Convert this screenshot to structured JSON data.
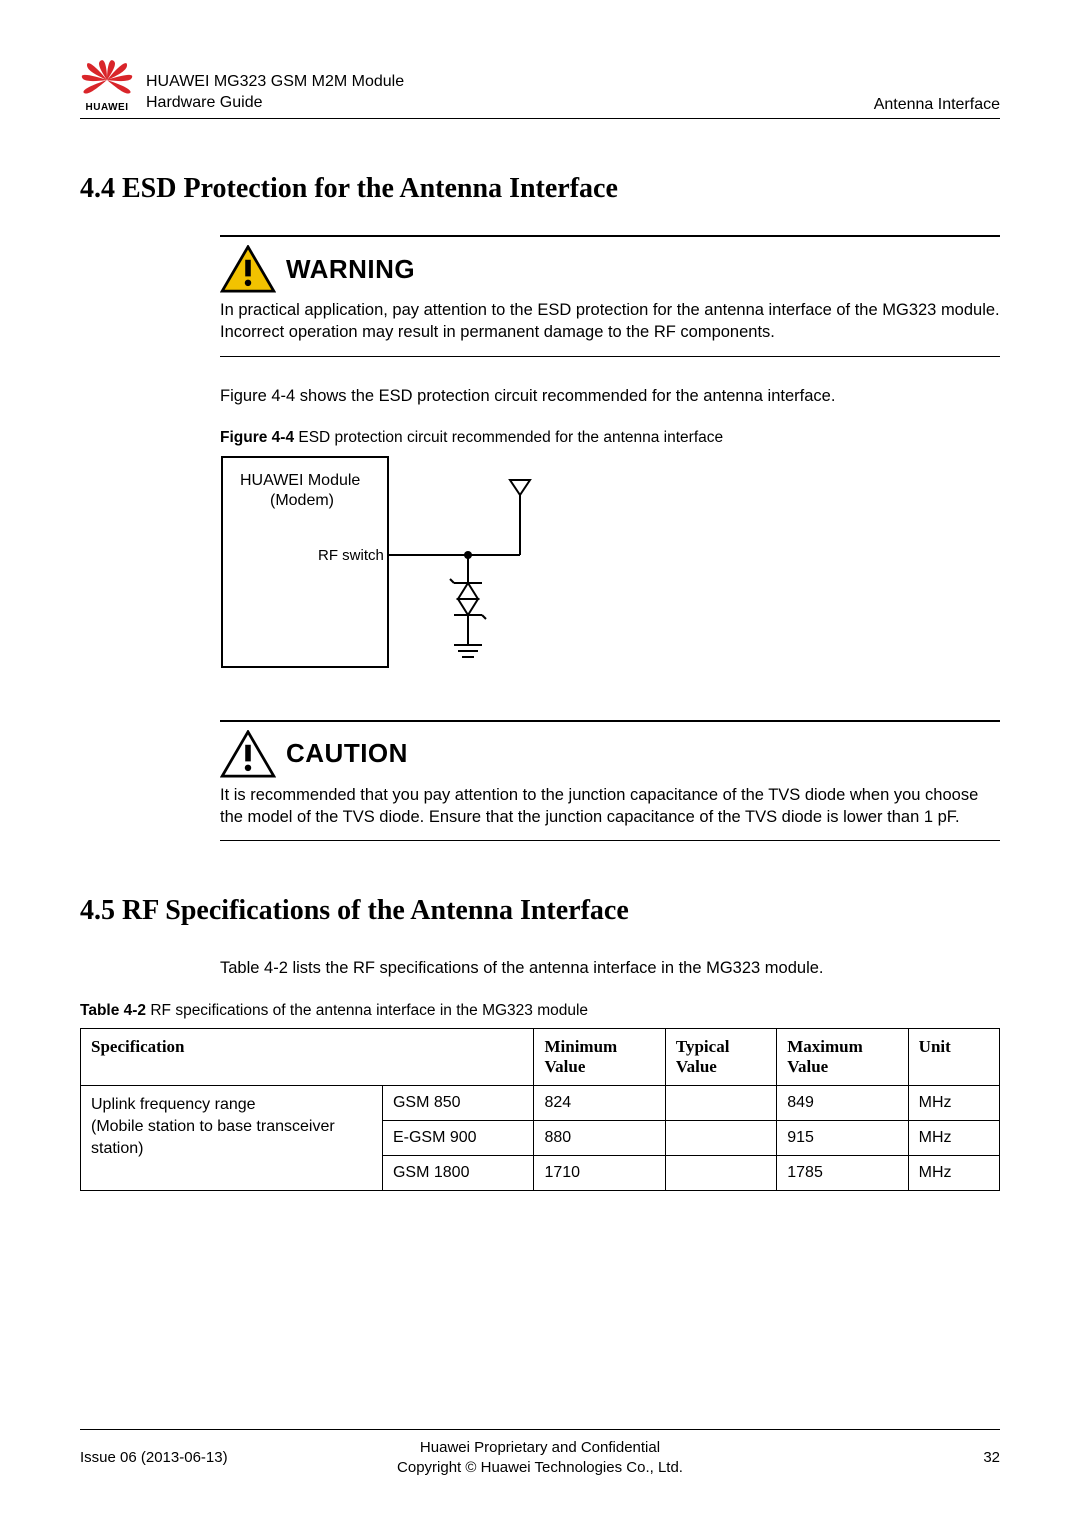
{
  "header": {
    "logo_brand": "HUAWEI",
    "doc_title_line1": "HUAWEI MG323 GSM M2M Module",
    "doc_title_line2": "Hardware Guide",
    "section_label": "Antenna Interface"
  },
  "section44": {
    "heading": "4.4 ESD Protection for the Antenna Interface",
    "warning_label": "WARNING",
    "warning_text": "In practical application, pay attention to the ESD protection for the antenna interface of the MG323 module. Incorrect operation may result in permanent damage to the RF components.",
    "intro_text": "Figure 4-4 shows the ESD protection circuit recommended for the antenna interface.",
    "figure_label": "Figure 4-4",
    "figure_caption": "  ESD protection circuit recommended for the antenna interface",
    "diagram": {
      "module_line1": "HUAWEI Module",
      "module_line2": "(Modem)",
      "port_label": "RF switch"
    },
    "caution_label": "CAUTION",
    "caution_text": "It is recommended that you pay attention to the junction capacitance of the TVS diode when you choose the model of the TVS diode. Ensure that the junction capacitance of the TVS diode is lower than 1 pF."
  },
  "section45": {
    "heading": "4.5 RF Specifications of the Antenna Interface",
    "intro_text": "Table 4-2 lists the RF specifications of the antenna interface in the MG323 module.",
    "table_label": "Table 4-2",
    "table_caption": "  RF specifications of the antenna interface in the MG323 module",
    "headers": {
      "spec": "Specification",
      "min": "Minimum Value",
      "typ": "Typical Value",
      "max": "Maximum Value",
      "unit": "Unit"
    },
    "rowgroup_label_line1": "Uplink frequency range",
    "rowgroup_label_line2": "(Mobile station to base transceiver station)",
    "rows": [
      {
        "band": "GSM 850",
        "min": "824",
        "typ": "",
        "max": "849",
        "unit": "MHz"
      },
      {
        "band": "E-GSM 900",
        "min": "880",
        "typ": "",
        "max": "915",
        "unit": "MHz"
      },
      {
        "band": "GSM 1800",
        "min": "1710",
        "typ": "",
        "max": "1785",
        "unit": "MHz"
      }
    ]
  },
  "footer": {
    "issue": "Issue 06 (2013-06-13)",
    "center_line1": "Huawei Proprietary and Confidential",
    "center_line2": "Copyright © Huawei Technologies Co., Ltd.",
    "page": "32"
  }
}
